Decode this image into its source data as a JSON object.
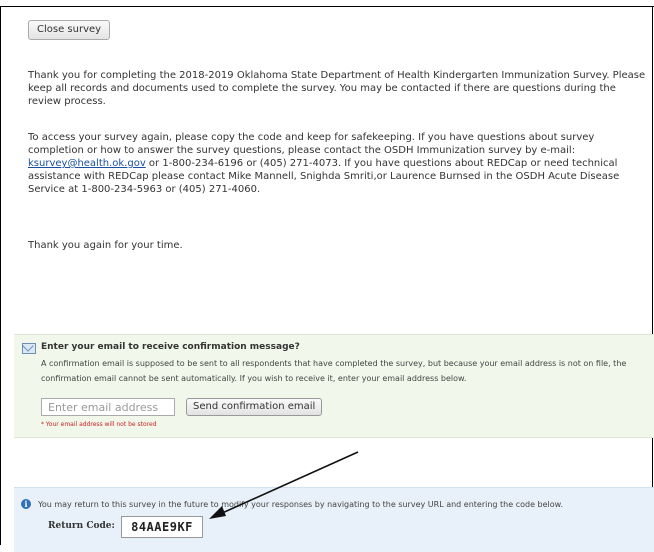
{
  "close_button_label": "Close survey",
  "message": {
    "paragraph1": "Thank you for completing the 2018-2019 Oklahoma State Department of Health Kindergarten Immunization Survey. Please keep all records and documents used to complete the survey. You may be contacted if there are questions during the review process.",
    "paragraph2_before_link": "To access your survey again, please copy the code and keep for safekeeping. If you have questions about survey completion or how to answer the survey questions, please contact the OSDH Immunization survey by e-mail: ",
    "email_link": "ksurvey@health.ok.gov",
    "paragraph2_after_link": " or 1-800-234-6196 or (405) 271-4073. If you have questions about REDCap or need technical assistance with REDCap please contact Mike Mannell, Snighda Smriti,or Laurence Burnsed in the OSDH Acute Disease Service at 1-800-234-5963 or (405) 271-4060.",
    "paragraph3": "Thank you again for your time."
  },
  "email_section": {
    "title": "Enter your email to receive confirmation message?",
    "description": "A confirmation email is supposed to be sent to all respondents that have completed the survey, but because your email address is not on file, the confirmation email cannot be sent automatically. If you wish to receive it, enter your email address below.",
    "input_placeholder": "Enter email address",
    "send_button_label": "Send confirmation email",
    "note": "* Your email address will not be stored",
    "icon": "envelope-icon"
  },
  "return_section": {
    "icon": "info-icon",
    "text": "You may return to this survey in the future to modify your responses by navigating to the survey URL and entering the code below.",
    "code_label": "Return Code:",
    "code": "84AAE9KF"
  },
  "colors": {
    "email_box_bg": "#f1f7ea",
    "return_box_bg": "#e8f1f9",
    "link": "#1a4fa0",
    "note_red": "#cc2222"
  }
}
